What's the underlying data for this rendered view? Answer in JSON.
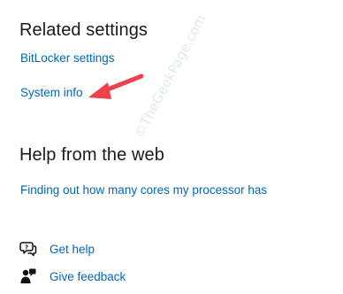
{
  "related_settings": {
    "title": "Related settings",
    "links": {
      "bitlocker": "BitLocker settings",
      "system_info": "System info"
    }
  },
  "help_from_web": {
    "title": "Help from the web",
    "links": {
      "cores": "Finding out how many cores my processor has"
    }
  },
  "actions": {
    "get_help": {
      "label": "Get help",
      "icon": "chat-help-icon"
    },
    "give_feedback": {
      "label": "Give feedback",
      "icon": "feedback-icon"
    }
  },
  "watermark": "©TheGeekPage.com",
  "colors": {
    "link": "#0067b8",
    "heading": "#1a1a1a",
    "annotation_arrow": "#f0404a"
  }
}
